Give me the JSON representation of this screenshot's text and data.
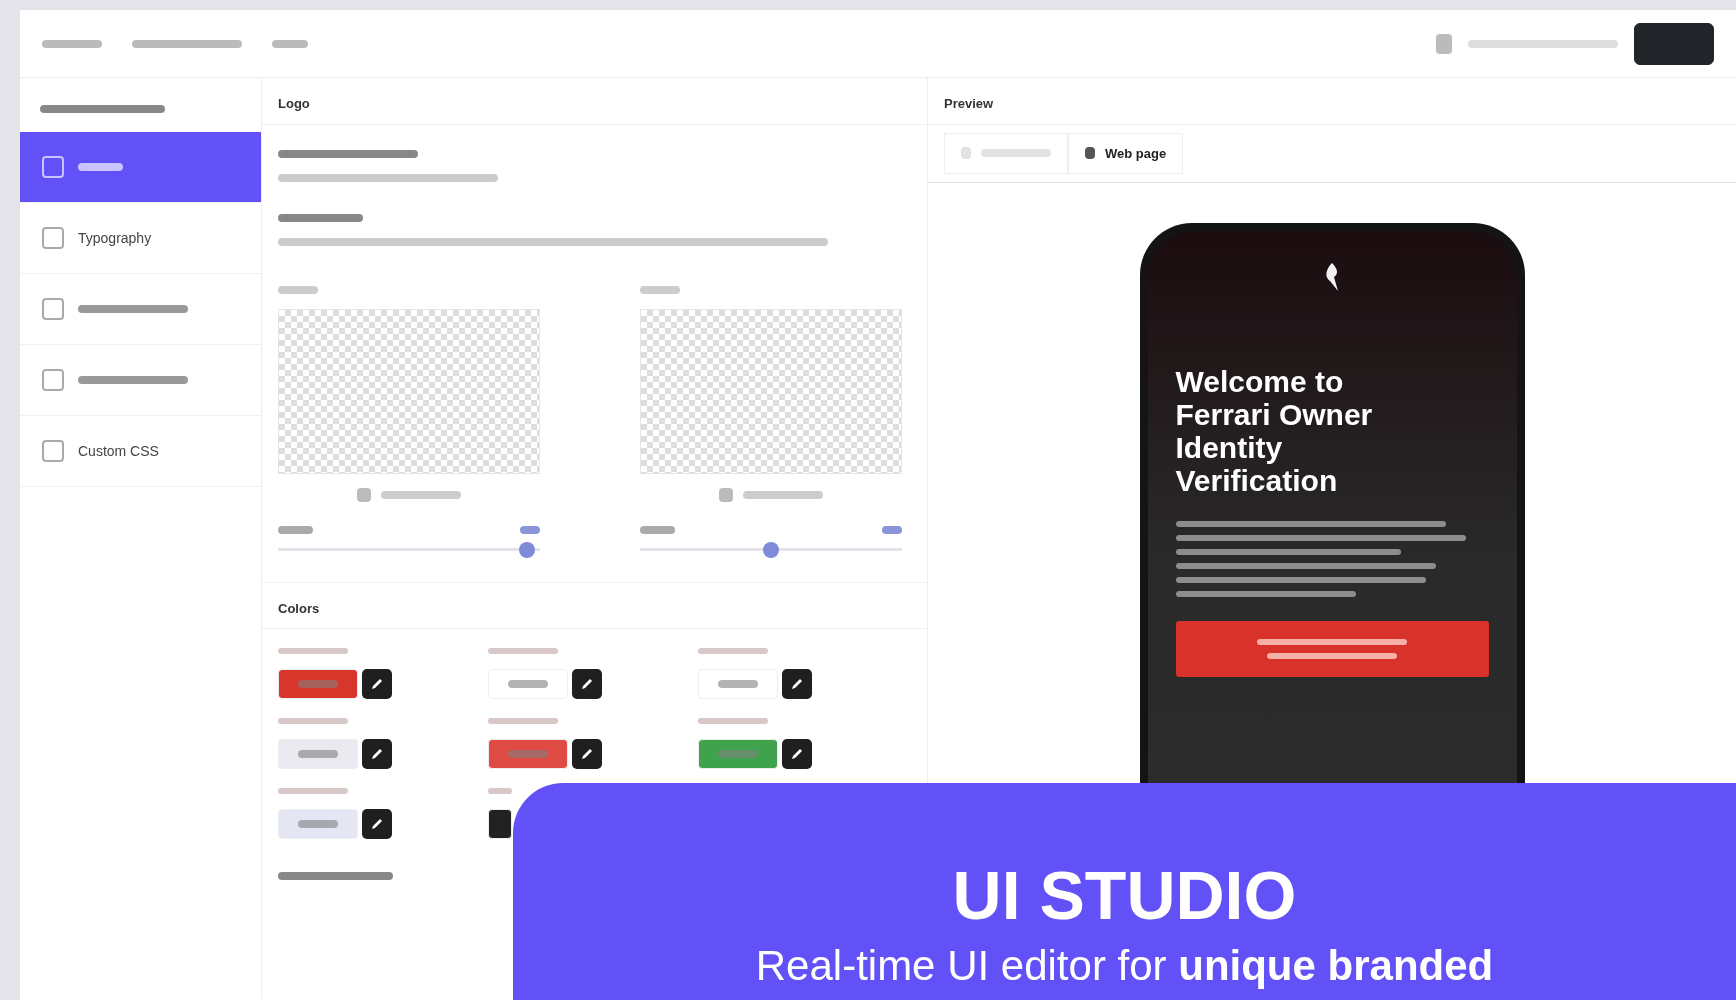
{
  "sidebar": {
    "items": [
      {
        "selected": true
      },
      {
        "label": "Typography",
        "selected": false
      },
      {
        "selected": false
      },
      {
        "selected": false
      },
      {
        "label": "Custom CSS",
        "selected": false
      }
    ]
  },
  "logo_panel": {
    "title": "Logo",
    "sliders": [
      {
        "level": 0.98
      },
      {
        "level": 0.5
      }
    ]
  },
  "colors": {
    "title": "Colors",
    "swatches": [
      {
        "color": "#d9362b"
      },
      {
        "color": "#ffffff"
      },
      {
        "color": "#ffffff"
      },
      {
        "color": "#e9e9ef"
      },
      {
        "color": "#de4b45"
      },
      {
        "color": "#3fa34d"
      },
      {
        "color": "#e4e7f3"
      },
      {
        "color": "#222222"
      }
    ]
  },
  "preview": {
    "title": "Preview",
    "tabs": [
      {
        "selected": false
      },
      {
        "label": "Web page",
        "selected": true
      }
    ],
    "phone": {
      "title": "Welcome to Ferrari Owner Identity Verification"
    }
  },
  "promo": {
    "title": "UI STUDIO",
    "subtitle": "Real-time UI editor for **unique branded**"
  }
}
